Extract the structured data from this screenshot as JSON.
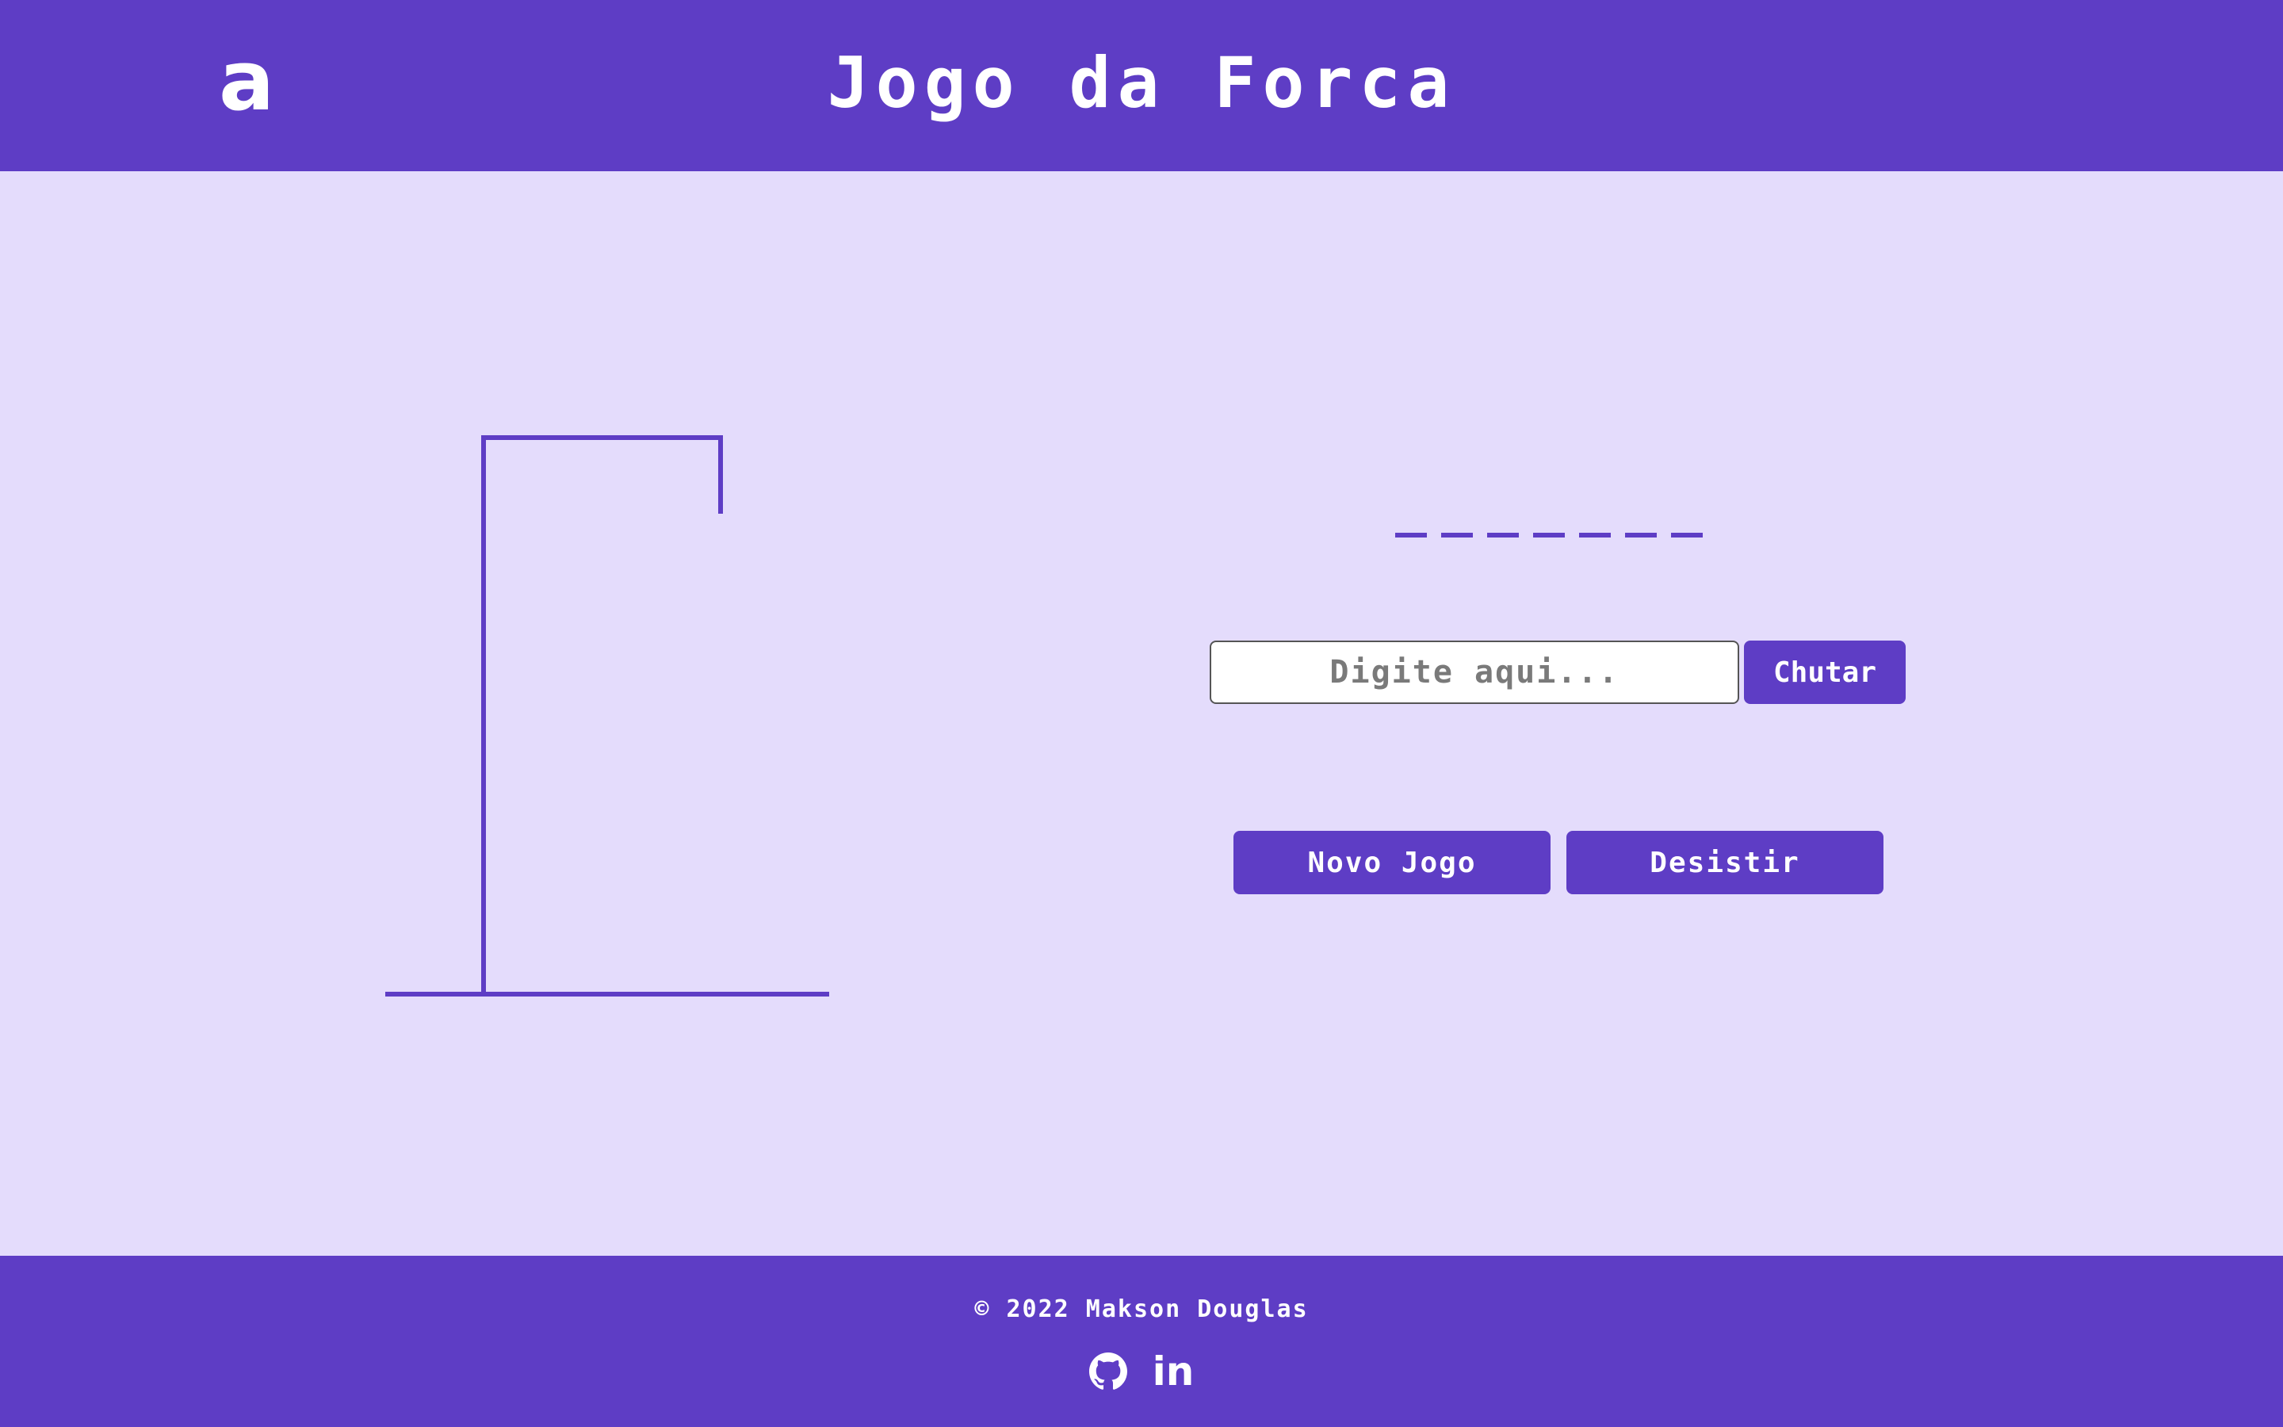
{
  "header": {
    "logo_text": "a",
    "title": "Jogo da Forca"
  },
  "game": {
    "word_slots": [
      "_",
      "_",
      "_",
      "_",
      "_",
      "_",
      "_"
    ],
    "guess_input": {
      "placeholder": "Digite aqui...",
      "value": ""
    },
    "guess_button_label": "Chutar",
    "new_game_label": "Novo Jogo",
    "give_up_label": "Desistir"
  },
  "footer": {
    "copyright": "© 2022 Makson Douglas",
    "social": [
      {
        "icon": "github-icon"
      },
      {
        "icon": "linkedin-icon",
        "label": "in"
      }
    ]
  },
  "colors": {
    "primary": "#5e3dc5",
    "background": "#e4dcfc",
    "text_light": "#ffffff"
  }
}
